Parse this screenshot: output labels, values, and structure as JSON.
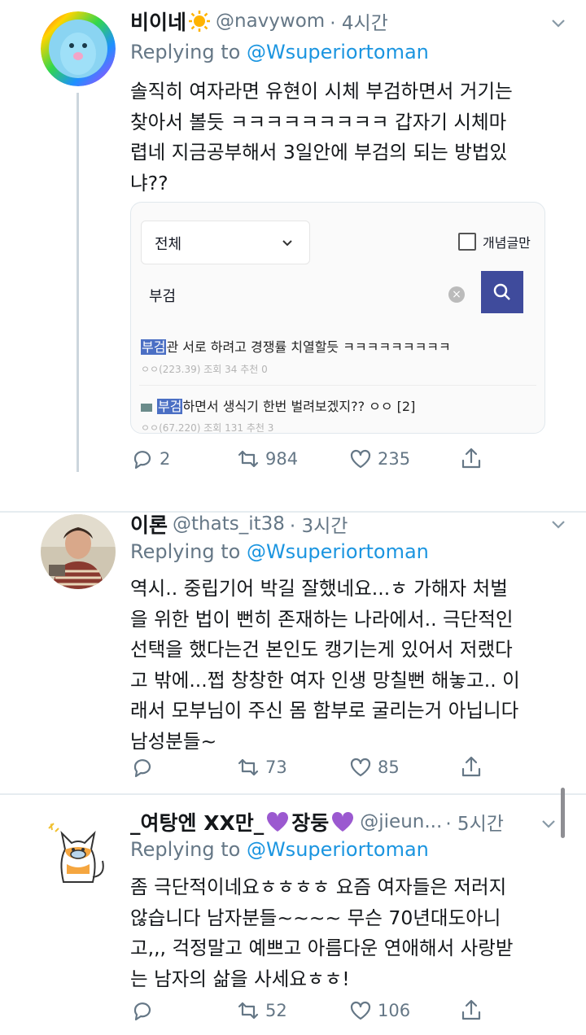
{
  "tweets": [
    {
      "name": "비이네",
      "emoji": "☀",
      "handle": "@navywom",
      "time": "· 4시간",
      "replying_prefix": "Replying to",
      "replying_to": "@Wsuperiortoman",
      "lines": [
        "솔직히 여자라면 유현이 시체 부검하면서 거기는",
        "찾아서 볼듯 ㅋㅋㅋㅋㅋㅋㅋㅋㅋ 갑자기 시체마",
        "렵네 지금공부해서 3일안에 부검의 되는 방법있",
        "냐??"
      ],
      "replies": "2",
      "retweets": "984",
      "likes": "235"
    },
    {
      "name": "이론",
      "handle": "@thats_it38",
      "time": "· 3시간",
      "replying_prefix": "Replying to",
      "replying_to": "@Wsuperiortoman",
      "lines": [
        "역시.. 중립기어 박길 잘했네요...ㅎ 가해자 처벌",
        "을 위한 법이 뻔히 존재하는 나라에서.. 극단적인",
        "선택을 했다는건 본인도 캥기는게 있어서 저랬다",
        "고 밖에...쩝 창창한 여자 인생 망칠뻔 해놓고.. 이",
        "래서 모부님이 주신 몸 함부로 굴리는거 아닙니다",
        "남성분들~"
      ],
      "replies": "",
      "retweets": "73",
      "likes": "85"
    },
    {
      "name_part1": "_여탕엔 XX만_",
      "name_part2": "장둥",
      "handle": "@jieun...",
      "time": "· 5시간",
      "replying_prefix": "Replying to",
      "replying_to": "@Wsuperiortoman",
      "lines": [
        "좀 극단적이네요ㅎㅎㅎㅎ 요즘 여자들은 저러지",
        "않습니다 남자분들~~~~ 무슨 70년대도아니",
        "고,,, 걱정말고 예쁘고 아름다운 연애해서 사랑받",
        "는 남자의 삶을 사세요ㅎㅎ!"
      ],
      "replies": "",
      "retweets": "52",
      "likes": "106"
    }
  ],
  "card": {
    "select_value": "전체",
    "checkbox_label": "개념글만",
    "search_value": "부검",
    "results": [
      {
        "highlight": "부검",
        "rest": "관 서로 하려고 경쟁률 치열할듯 ㅋㅋㅋㅋㅋㅋㅋㅋㅋ",
        "meta": "ㅇㅇ(223.39) 조회 34 추천 0"
      },
      {
        "highlight": "부검",
        "rest": "하면서 생식기 한번 벌려보겠지?? ㅇㅇ [2]",
        "meta": "ㅇㅇ(67.220) 조회 131 추천 3"
      }
    ]
  },
  "colors": {
    "link": "#1b95e0",
    "muted": "#657786",
    "search_button": "#3f4b9c",
    "highlight": "#4b6fc4",
    "heart": "#9b59d0"
  },
  "icons": [
    "reply-icon",
    "retweet-icon",
    "like-icon",
    "share-icon",
    "chevron-down-icon",
    "search-icon",
    "clear-icon",
    "purple-heart-icon",
    "sun-emoji-icon"
  ]
}
